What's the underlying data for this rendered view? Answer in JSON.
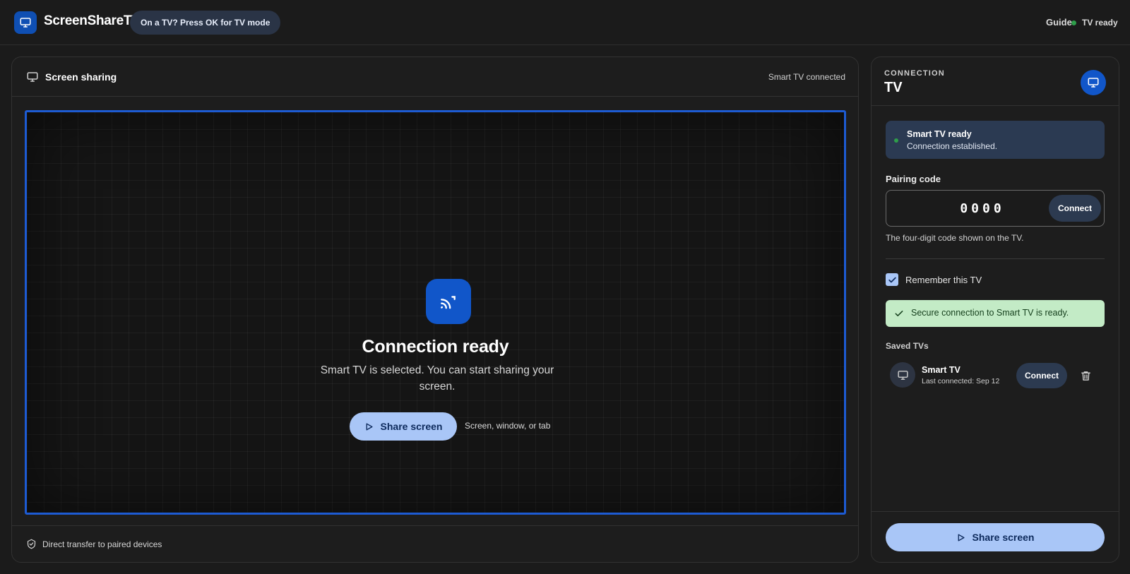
{
  "app": {
    "title": "ScreenShareTV",
    "tv_mode_hint": "On a TV? Press OK for TV mode",
    "guide_label": "Guide",
    "status_label": "TV ready",
    "status_color": "#2e9e4a",
    "logo_icon": "monitor-icon"
  },
  "main": {
    "title": "Screen sharing",
    "status": "Smart TV connected",
    "stage": {
      "icon": "cast-icon",
      "heading": "Connection ready",
      "description": "Smart TV is selected. You can start sharing your screen.",
      "share_label": "Share screen",
      "share_hint": "Screen, window, or tab"
    },
    "footer_text": "Direct transfer to paired devices"
  },
  "side": {
    "eyebrow": "CONNECTION",
    "title": "TV",
    "status_card": {
      "title": "Smart TV ready",
      "subtitle": "Connection established."
    },
    "pairing": {
      "label": "Pairing code",
      "value": "0000",
      "connect_label": "Connect",
      "help": "The four-digit code shown on the TV."
    },
    "remember": {
      "label": "Remember this TV",
      "checked": true
    },
    "success_message": "Secure connection to Smart TV is ready.",
    "saved": {
      "heading": "Saved TVs",
      "items": [
        {
          "name": "Smart TV",
          "meta": "Last connected: Sep 12",
          "connect_label": "Connect"
        }
      ]
    },
    "share_label": "Share screen"
  },
  "colors": {
    "accent": "#1156c9",
    "stage_border": "#1d5bd3",
    "primary_button": "#a9c6f7",
    "success_bg": "#c3ebc6"
  }
}
